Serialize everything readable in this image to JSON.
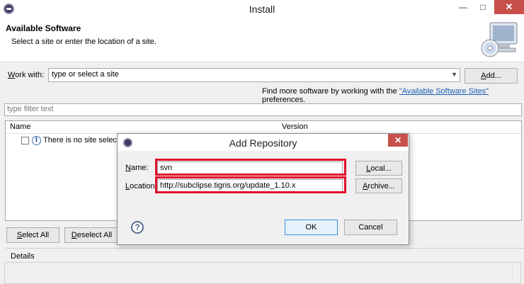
{
  "window": {
    "title": "Install",
    "minimize": "—",
    "maximize": "□",
    "close": "✕"
  },
  "banner": {
    "title": "Available Software",
    "subtitle": "Select a site or enter the location of a site."
  },
  "work_with": {
    "label_key": "W",
    "label_rest": "ork with:",
    "value": "type or select a site",
    "add_key": "A",
    "add_rest": "dd..."
  },
  "find_more": {
    "prefix": "Find more software by working with the ",
    "link": "\"Available Software Sites\"",
    "suffix": " preferences."
  },
  "filter": {
    "placeholder": "type filter text"
  },
  "table": {
    "columns": [
      "Name",
      "Version"
    ],
    "rows": [
      {
        "text": "There is no site selecte"
      }
    ]
  },
  "buttons": {
    "select_all_key": "S",
    "select_all_rest": "elect All",
    "deselect_all_key": "D",
    "deselect_all_rest": "eselect All"
  },
  "details": {
    "label": "Details"
  },
  "dialog": {
    "title": "Add Repository",
    "close": "✕",
    "name_label_key": "N",
    "name_label_rest": "ame:",
    "name_value": "svn",
    "location_label_key": "L",
    "location_label_rest": "ocation:",
    "location_value": "http://subclipse.tigris.org/update_1.10.x",
    "local_key": "L",
    "local_rest": "ocal...",
    "archive_key": "A",
    "archive_rest": "rchive...",
    "ok": "OK",
    "cancel": "Cancel",
    "help": "?"
  },
  "colors": {
    "highlight": "#e0102a",
    "link": "#1a5fb4",
    "close_button": "#c7504a"
  }
}
